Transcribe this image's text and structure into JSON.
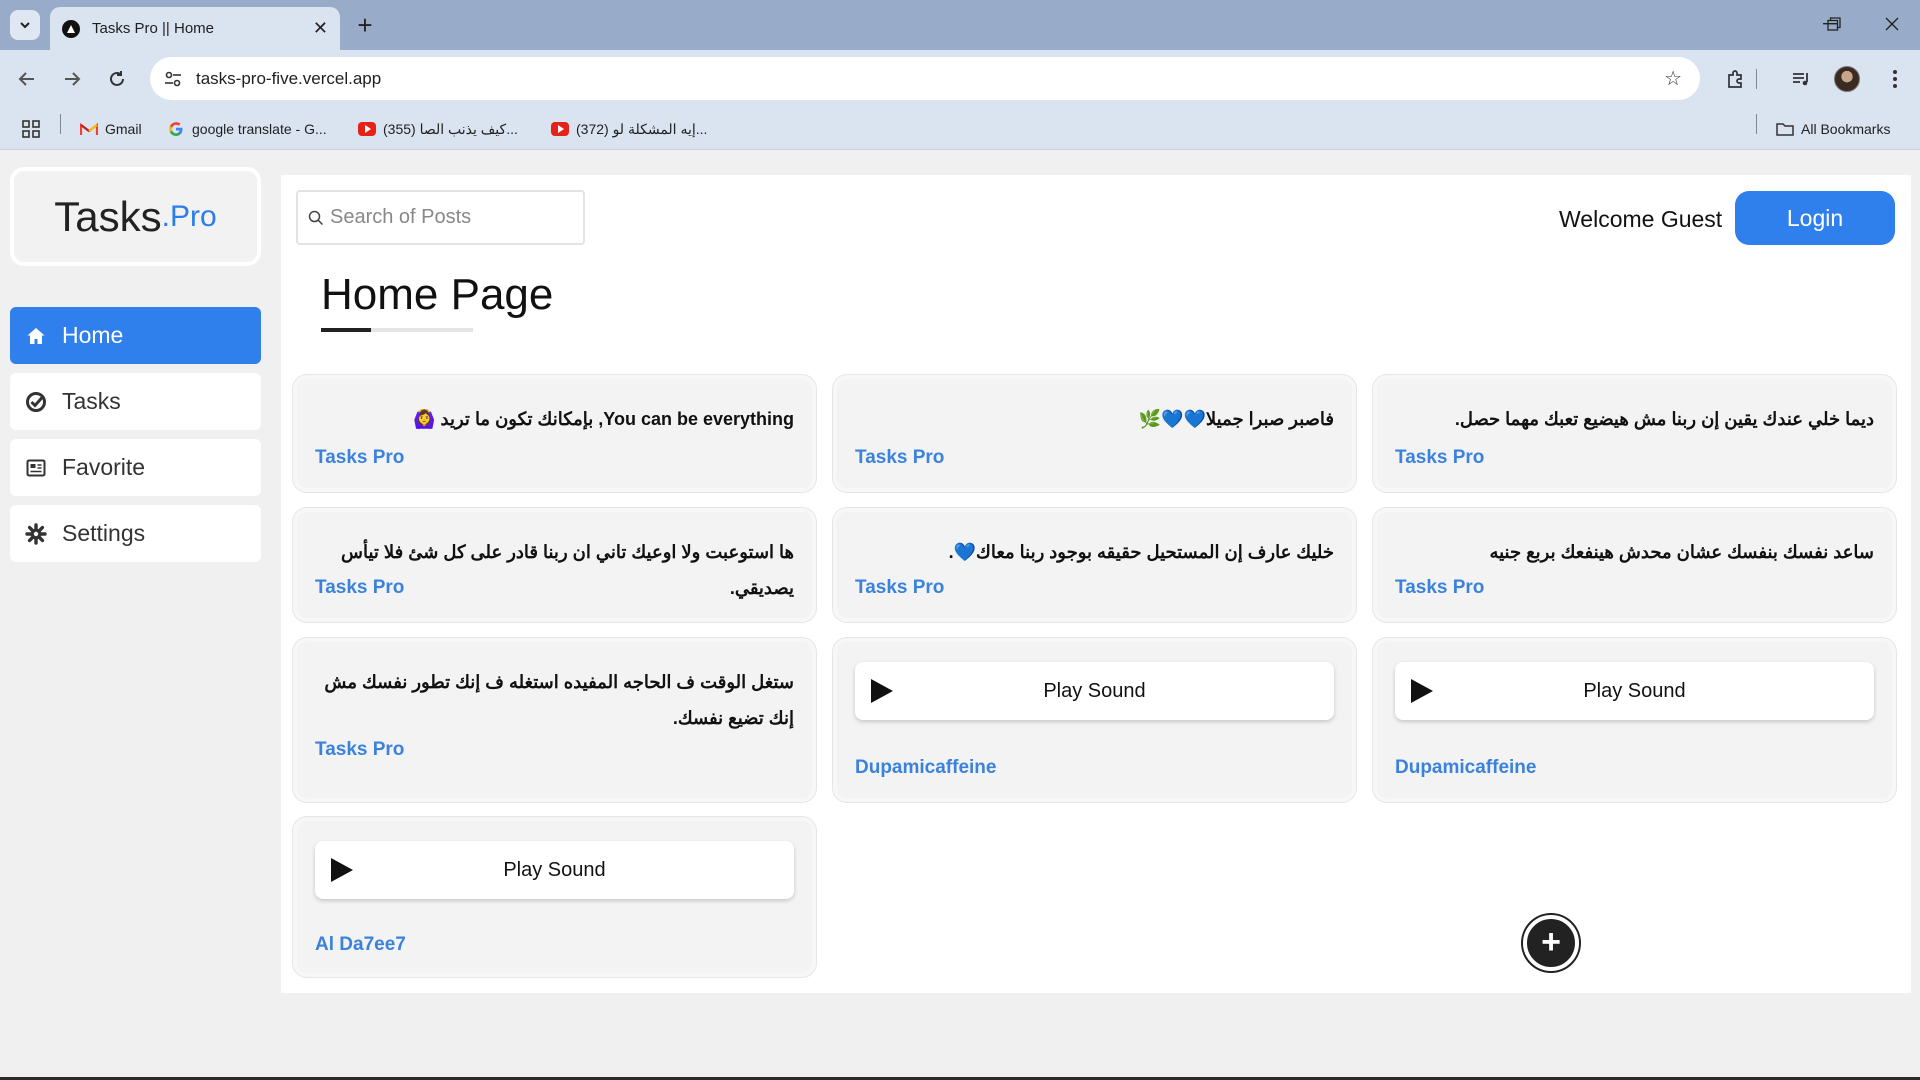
{
  "browser": {
    "tab_title": "Tasks Pro || Home",
    "new_tab": "+",
    "url": "tasks-pro-five.vercel.app",
    "bookmarks": [
      {
        "label": "Gmail",
        "icon": "gmail-icon"
      },
      {
        "label": "google translate - G...",
        "icon": "google-icon"
      },
      {
        "label": "(355) كيف يذنب الصا...",
        "icon": "youtube-icon"
      },
      {
        "label": "(372) إيه المشكلة لو...",
        "icon": "youtube-icon"
      }
    ],
    "all_bookmarks": "All Bookmarks"
  },
  "app": {
    "logo": {
      "main": "Tasks",
      "dot_pro": ".Pro"
    },
    "sidebar": [
      {
        "label": "Home",
        "icon": "home-icon",
        "active": true
      },
      {
        "label": "Tasks",
        "icon": "check-circle-icon",
        "active": false
      },
      {
        "label": "Favorite",
        "icon": "newspaper-icon",
        "active": false
      },
      {
        "label": "Settings",
        "icon": "gear-icon",
        "active": false
      }
    ],
    "search_placeholder": "Search of Posts",
    "welcome": "Welcome Guest",
    "login": "Login",
    "page_title": "Home Page",
    "accent_color": "#2f80ed",
    "author_color": "#3b82dc",
    "posts": [
      {
        "text": "You can be everything, بإمكانك تكون ما تريد 🙆‍♀️",
        "author": "Tasks Pro"
      },
      {
        "text": "فاصبر صبرا جميلا💙💙🌿",
        "author": "Tasks Pro"
      },
      {
        "text": "ديما خلي عندك يقين إن ربنا مش هيضيع تعبك مهما حصل.",
        "author": "Tasks Pro"
      },
      {
        "text": "ها استوعبت ولا اوعيك تاني ان ربنا قادر على كل شئ فلا تيأس يصديقي.",
        "author": "Tasks Pro"
      },
      {
        "text": "خليك عارف إن المستحيل حقيقه بوجود ربنا معاك💙.",
        "author": "Tasks Pro"
      },
      {
        "text": "ساعد نفسك بنفسك عشان محدش هينفعك بربع جنيه",
        "author": "Tasks Pro"
      },
      {
        "text": "ستغل الوقت ف الحاجه المفيده استغله ف إنك تطور نفسك مش إنك تضيع نفسك.",
        "author": "Tasks Pro"
      },
      {
        "sound_label": "Play Sound",
        "author": "Dupamicaffeine"
      },
      {
        "sound_label": "Play Sound",
        "author": "Dupamicaffeine"
      },
      {
        "sound_label": "Play Sound",
        "author": "Al Da7ee7"
      }
    ],
    "fab": "+"
  }
}
